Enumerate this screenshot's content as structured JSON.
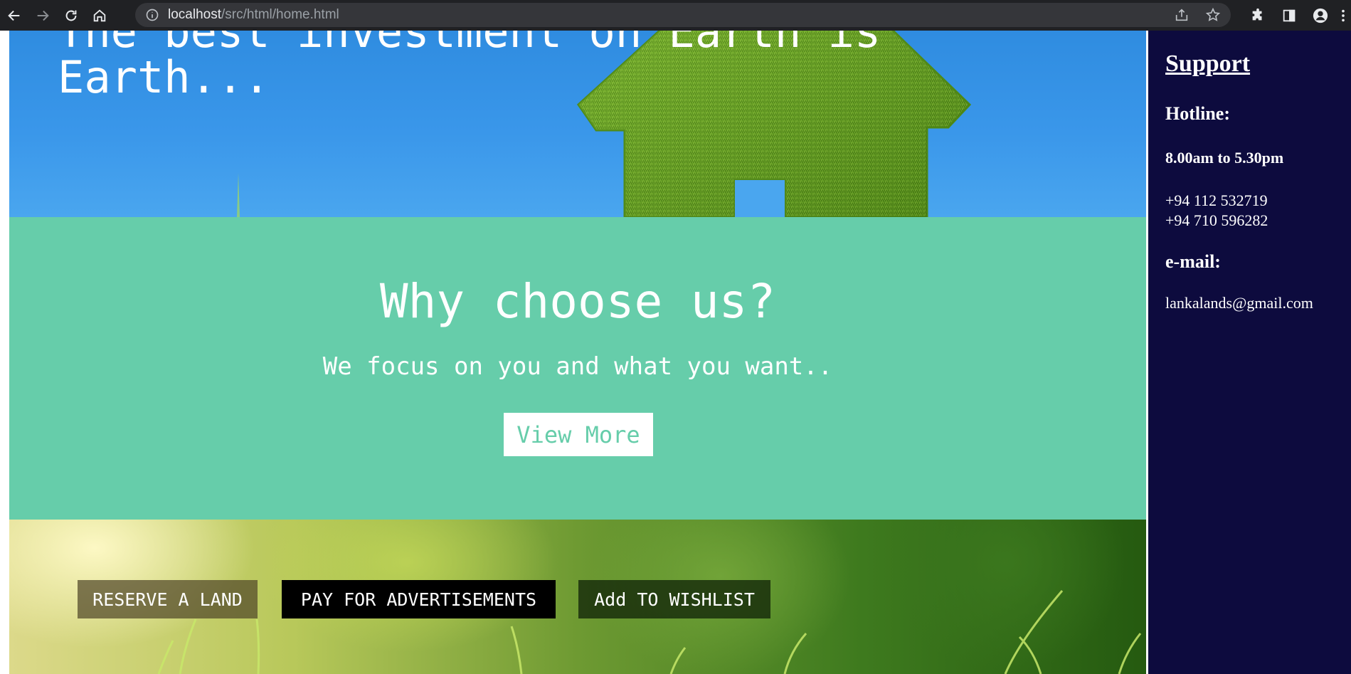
{
  "browser": {
    "url_host": "localhost",
    "url_path": "/src/html/home.html",
    "icons": [
      "back-arrow-icon",
      "forward-arrow-icon",
      "reload-icon",
      "home-icon",
      "info-icon",
      "share-icon",
      "star-icon",
      "extensions-icon",
      "side-panel-icon",
      "profile-icon",
      "menu-icon"
    ]
  },
  "hero": {
    "title": "The best investment on Earth is Earth..."
  },
  "why": {
    "title": "Why choose us?",
    "subtitle": "We focus on you and what you want..",
    "button_label": "View More"
  },
  "banner": {
    "buttons": [
      {
        "label": "RESERVE A LAND"
      },
      {
        "label": "PAY FOR ADVERTISEMENTS"
      },
      {
        "label": "Add TO WISHLIST"
      }
    ]
  },
  "sidebar": {
    "title": "Support",
    "hotline_label": "Hotline:",
    "hours": "8.00am to 5.30pm",
    "phones": [
      "+94 112 532719",
      "+94 710 596282"
    ],
    "email_label": "e-mail:",
    "email": "lankalands@gmail.com"
  },
  "colors": {
    "teal": "#66cdaa",
    "navy": "#0d0b3e",
    "sky": "#3a97ea"
  }
}
